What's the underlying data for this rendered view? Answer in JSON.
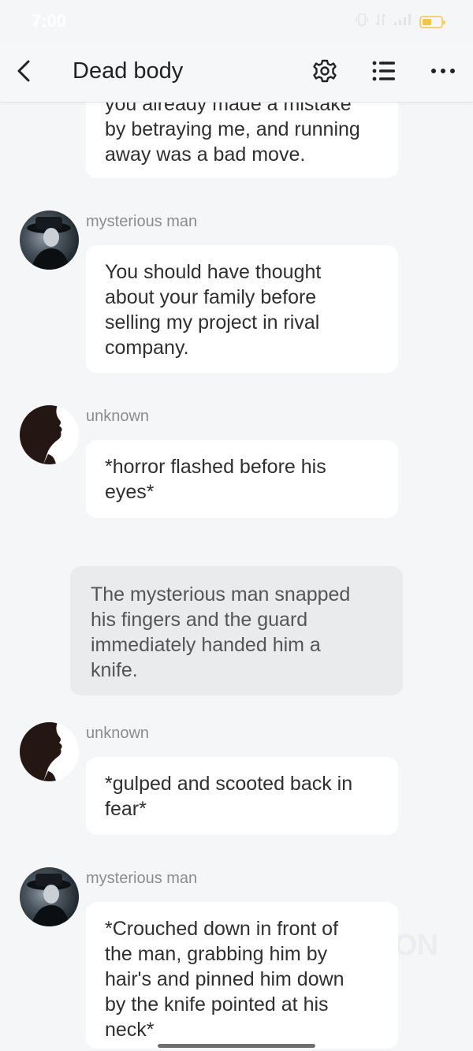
{
  "status": {
    "time": "7:00"
  },
  "header": {
    "title": "Dead body"
  },
  "icons": {
    "back": "chevron-left-icon",
    "settings": "gear-icon",
    "list": "list-icon",
    "more": "more-horizontal-icon"
  },
  "messages": [
    {
      "type": "bubble",
      "lines": [
        "you already made a mistake",
        "by betraying me, and running",
        "away was a bad move."
      ]
    },
    {
      "type": "bubble",
      "sender": "mysterious man",
      "lines": [
        "You should have thought",
        "about your family before",
        "selling my project in rival",
        "company."
      ]
    },
    {
      "type": "bubble",
      "sender": "unknown",
      "lines": [
        "*horror flashed before his",
        "eyes*"
      ]
    },
    {
      "type": "narration",
      "lines": [
        "The mysterious man snapped",
        "his fingers and the guard",
        "immediately handed him a",
        "knife."
      ]
    },
    {
      "type": "bubble",
      "sender": "unknown",
      "lines": [
        "*gulped and scooted back in",
        "fear*"
      ]
    },
    {
      "type": "bubble",
      "sender": "mysterious man",
      "lines": [
        "*Crouched down in front of",
        "the man, grabbing him by",
        "hair's and pinned him down",
        "by the knife pointed at his",
        "neck*"
      ]
    }
  ],
  "watermark": "ON"
}
